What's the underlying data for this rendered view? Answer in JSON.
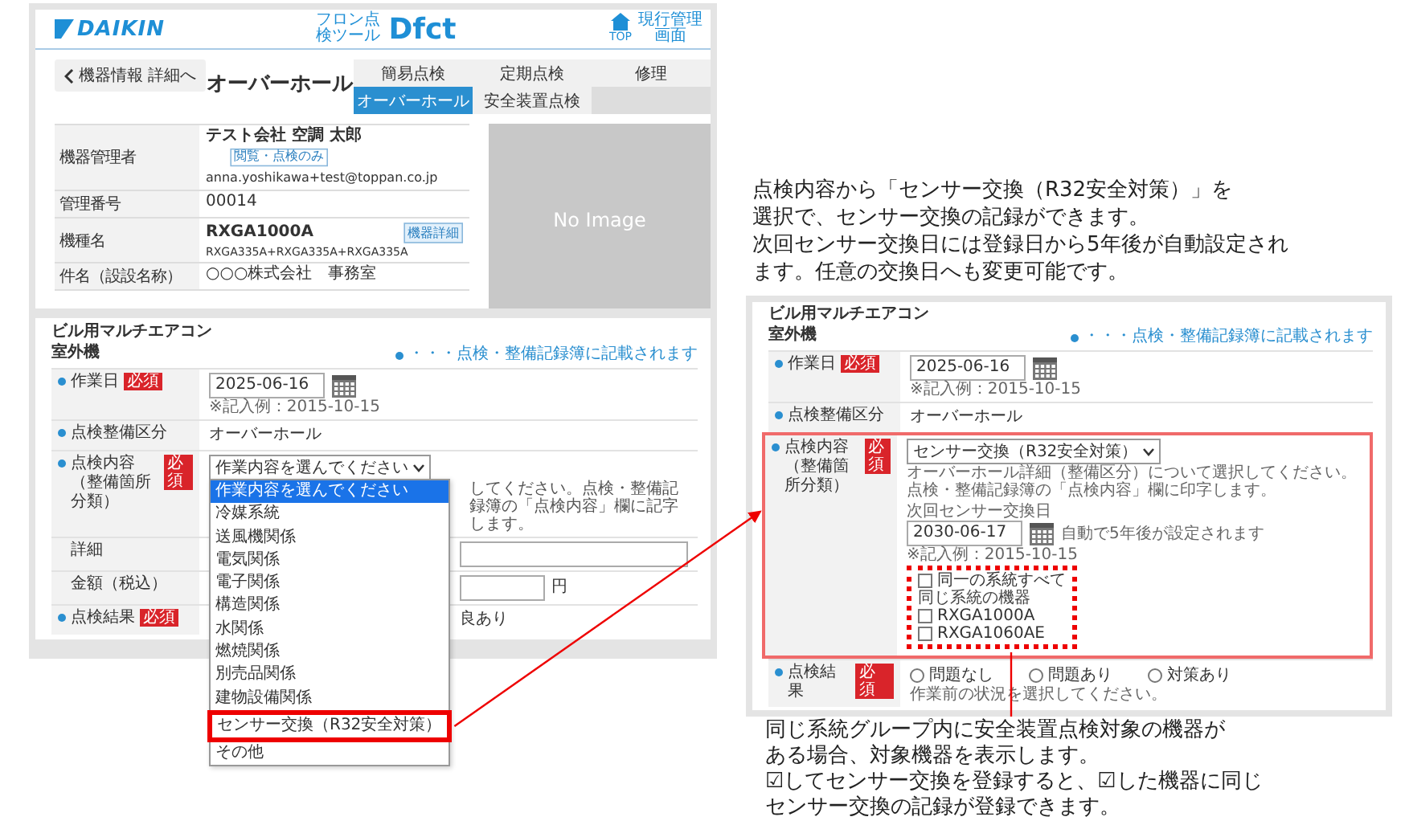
{
  "top_screen": {
    "header": {
      "logo": "DAIKIN",
      "app_caption": "フロン点検ツール",
      "app_name": "Dfct",
      "home_label": "TOP",
      "admin_label": "現行管理画面"
    },
    "back_button": "機器情報 詳細へ",
    "title": "オーバーホール",
    "tabs": [
      {
        "label": "簡易点検",
        "selected": false
      },
      {
        "label": "定期点検",
        "selected": false
      },
      {
        "label": "修理",
        "selected": false
      },
      {
        "label": "オーバーホール",
        "selected": true
      },
      {
        "label": "安全装置点検",
        "selected": false
      }
    ],
    "info_rows": [
      {
        "kind": "manager",
        "label": "機器管理者",
        "value": "テスト会社 空調 太郎",
        "badge": "閲覧・点検のみ",
        "email": "anna.yoshikawa+test@toppan.co.jp"
      },
      {
        "kind": "text",
        "label": "管理番号",
        "value": "00014"
      },
      {
        "kind": "model",
        "label": "機種名",
        "value": "RXGA1000A",
        "badge": "機器詳細",
        "sub": "RXGA335A+RXGA335A+RXGA335A"
      },
      {
        "kind": "text",
        "label": "件名（設設名称）",
        "value": "○○○株式会社　事務室"
      }
    ],
    "image_placeholder": "No Image"
  },
  "left_form": {
    "unit_type": "ビル用マルチエアコン",
    "unit_part": "室外機",
    "legend": "・・・点検・整備記録簿に記載されます",
    "rows": [
      {
        "kind": "date",
        "label": "作業日",
        "marked": true,
        "required": "必須",
        "value": "2025-06-16",
        "example": "※記入例：2015-10-15"
      },
      {
        "kind": "text",
        "label": "点検整備区分",
        "marked": true,
        "value": "オーバーホール"
      },
      {
        "kind": "select",
        "label": "点検内容",
        "sublabel": "（整備箇所分類）",
        "marked": true,
        "required": "必須",
        "value": "作業内容を選んでください",
        "hint": "してください。点検・整備記録簿の「点検内容」欄に記字します。",
        "options": [
          {
            "label": "作業内容を選んでください",
            "selected": true,
            "emphasized": false
          },
          {
            "label": "冷媒系統",
            "selected": false,
            "emphasized": false
          },
          {
            "label": "送風機関係",
            "selected": false,
            "emphasized": false
          },
          {
            "label": "電気関係",
            "selected": false,
            "emphasized": false
          },
          {
            "label": "電子関係",
            "selected": false,
            "emphasized": false
          },
          {
            "label": "構造関係",
            "selected": false,
            "emphasized": false
          },
          {
            "label": "水関係",
            "selected": false,
            "emphasized": false
          },
          {
            "label": "燃焼関係",
            "selected": false,
            "emphasized": false
          },
          {
            "label": "別売品関係",
            "selected": false,
            "emphasized": false
          },
          {
            "label": "建物設備関係",
            "selected": false,
            "emphasized": false
          },
          {
            "label": "センサー交換（R32安全対策）",
            "selected": false,
            "emphasized": true
          },
          {
            "label": "その他",
            "selected": false,
            "emphasized": false
          }
        ]
      },
      {
        "kind": "input",
        "label": "詳細",
        "marked": false
      },
      {
        "kind": "input",
        "label": "金額（税込）",
        "marked": false,
        "unit": "円"
      },
      {
        "kind": "text",
        "label": "点検結果",
        "marked": true,
        "required": "必須",
        "value": "良あり"
      }
    ]
  },
  "right_form": {
    "unit_type": "ビル用マルチエアコン",
    "unit_part": "室外機",
    "legend": "・・・点検・整備記録簿に記載されます",
    "rows": [
      {
        "kind": "date",
        "label": "作業日",
        "marked": true,
        "required": "必須",
        "value": "2025-06-16",
        "example": "※記入例：2015-10-15"
      },
      {
        "kind": "text",
        "label": "点検整備区分",
        "marked": true,
        "value": "オーバーホール"
      },
      {
        "kind": "sensor",
        "label": "点検内容",
        "sublabel": "（整備箇所分類）",
        "marked": true,
        "required": "必須",
        "value": "センサー交換（R32安全対策）",
        "hint": "オーバーホール詳細（整備区分）について選択してください。点検・整備記録簿の「点検内容」欄に印字します。",
        "next_label": "次回センサー交換日",
        "next_date": "2030-06-17",
        "auto_note": "自動で5年後が設定されます",
        "example": "※記入例：2015-10-15",
        "group_all": {
          "label": "同一の系統すべて",
          "checked": false
        },
        "group_caption": "同じ系統の機器",
        "units": [
          {
            "label": "RXGA1000A",
            "checked": false
          },
          {
            "label": "RXGA1060AE",
            "checked": false
          }
        ]
      },
      {
        "kind": "radios",
        "label": "点検結果",
        "marked": true,
        "required": "必須",
        "options": [
          {
            "label": "問題なし",
            "selected": false
          },
          {
            "label": "問題あり",
            "selected": false
          },
          {
            "label": "対策あり",
            "selected": false
          }
        ],
        "note": "作業前の状況を選択してください。"
      }
    ]
  },
  "callouts": [
    {
      "lines": [
        "点検内容から「センサー交換（R32安全対策）」を",
        "選択で、センサー交換の記録ができます。",
        "次回センサー交換日には登録日から5年後が自動設定され",
        "ます。任意の交換日へも変更可能です。"
      ]
    },
    {
      "lines": [
        "同じ系統グループ内に安全装置点検対象の機器が",
        "ある場合、対象機器を表示します。",
        "☑してセンサー交換を登録すると、☑した機器に同じ",
        "センサー交換の記録が登録できます。"
      ]
    }
  ]
}
